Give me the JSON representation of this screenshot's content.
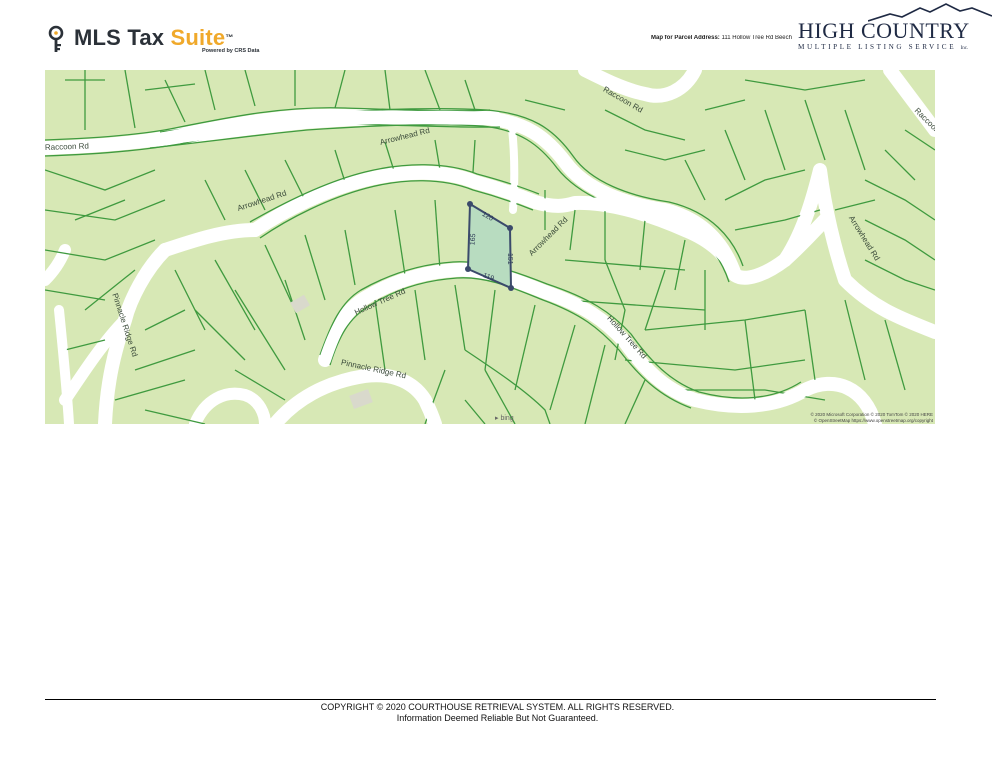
{
  "header": {
    "logo": {
      "brand": "MLS Tax ",
      "brand_accent": "Suite",
      "trademark": "™",
      "tagline": "Powered by CRS Data"
    },
    "map_for_label": "Map for Parcel Address:",
    "map_for_value": "111 Hollow Tree Rd Beech",
    "partner": {
      "title": "HIGH COUNTRY",
      "subtitle": "MULTIPLE LISTING SERVICE",
      "suffix": "Inc."
    }
  },
  "map": {
    "roads": {
      "raccoon_left": "Raccoon Rd",
      "raccoon_top": "Raccoon Rd",
      "raccoon_right": "Raccoon R",
      "arrowhead_upper": "Arrowhead Rd",
      "arrowhead_left": "Arrowhead Rd",
      "arrowhead_mid": "Arrowhead Rd",
      "arrowhead_right": "Arrowhead Rd",
      "hollow_tree_left": "Hollow Tree Rd",
      "hollow_tree_right": "Hollow Tree Rd",
      "pinnacle_ridge_left": "Pinnacle Ridge Rd",
      "pinnacle_ridge_bottom": "Pinnacle Ridge Rd"
    },
    "parcel": {
      "top": "120",
      "left": "165",
      "right": "151",
      "bottom": "119"
    },
    "provider": "bing",
    "attribution_1": "© 2020 Microsoft Corporation © 2020 TomTom © 2020 HERE",
    "attribution_2": "© OpenStreetMap https://www.openstreetmap.org/copyright"
  },
  "footer": {
    "copyright": "COPYRIGHT © 2020 COURTHOUSE RETRIEVAL SYSTEM. ALL RIGHTS RESERVED.",
    "disclaimer": "Information Deemed Reliable But Not Guaranteed."
  },
  "colors": {
    "land": "#d7e8b5",
    "road": "#ffffff",
    "lot_line": "#3f9a3f",
    "parcel_fill": "#b8dcc0",
    "parcel_stroke": "#3b4a6b",
    "accent": "#f0a92b",
    "brand_dark": "#1f2a44"
  }
}
